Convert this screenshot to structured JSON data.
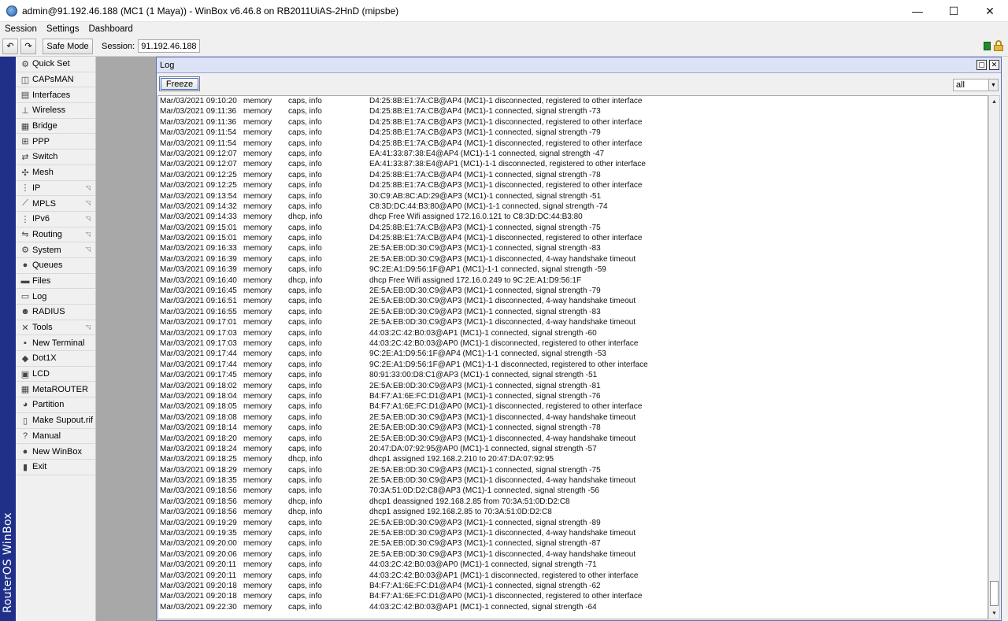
{
  "window": {
    "title": "admin@91.192.46.188 (MC1 (1 Maya)) - WinBox v6.46.8 on RB2011UiAS-2HnD (mipsbe)",
    "minimize": "—",
    "maximize": "☐",
    "close": "✕"
  },
  "menu": [
    "Session",
    "Settings",
    "Dashboard"
  ],
  "toolbar": {
    "undo": "↶",
    "redo": "↷",
    "safe_mode": "Safe Mode",
    "session_label": "Session:",
    "session_value": "91.192.46.188"
  },
  "brand_strip": "RouterOS WinBox",
  "sidebar": [
    {
      "label": "Quick Set",
      "icon": "quickset-icon",
      "glyph": "⚙",
      "submenu": false
    },
    {
      "label": "CAPsMAN",
      "icon": "capsman-icon",
      "glyph": "◫",
      "submenu": false
    },
    {
      "label": "Interfaces",
      "icon": "interfaces-icon",
      "glyph": "▤",
      "submenu": false
    },
    {
      "label": "Wireless",
      "icon": "wireless-icon",
      "glyph": "⊥",
      "submenu": false
    },
    {
      "label": "Bridge",
      "icon": "bridge-icon",
      "glyph": "▦",
      "submenu": false
    },
    {
      "label": "PPP",
      "icon": "ppp-icon",
      "glyph": "⊞",
      "submenu": false
    },
    {
      "label": "Switch",
      "icon": "switch-icon",
      "glyph": "⇄",
      "submenu": false
    },
    {
      "label": "Mesh",
      "icon": "mesh-icon",
      "glyph": "✣",
      "submenu": false
    },
    {
      "label": "IP",
      "icon": "ip-icon",
      "glyph": "⋮",
      "submenu": true
    },
    {
      "label": "MPLS",
      "icon": "mpls-icon",
      "glyph": "⟋",
      "submenu": true
    },
    {
      "label": "IPv6",
      "icon": "ipv6-icon",
      "glyph": "⋮",
      "submenu": true
    },
    {
      "label": "Routing",
      "icon": "routing-icon",
      "glyph": "⇋",
      "submenu": true
    },
    {
      "label": "System",
      "icon": "system-icon",
      "glyph": "⚙",
      "submenu": true
    },
    {
      "label": "Queues",
      "icon": "queues-icon",
      "glyph": "●",
      "submenu": false
    },
    {
      "label": "Files",
      "icon": "files-icon",
      "glyph": "▬",
      "submenu": false
    },
    {
      "label": "Log",
      "icon": "log-icon",
      "glyph": "▭",
      "submenu": false
    },
    {
      "label": "RADIUS",
      "icon": "radius-icon",
      "glyph": "☻",
      "submenu": false
    },
    {
      "label": "Tools",
      "icon": "tools-icon",
      "glyph": "✕",
      "submenu": true
    },
    {
      "label": "New Terminal",
      "icon": "terminal-icon",
      "glyph": "▪",
      "submenu": false
    },
    {
      "label": "Dot1X",
      "icon": "dot1x-icon",
      "glyph": "◆",
      "submenu": false
    },
    {
      "label": "LCD",
      "icon": "lcd-icon",
      "glyph": "▣",
      "submenu": false
    },
    {
      "label": "MetaROUTER",
      "icon": "metarouter-icon",
      "glyph": "▦",
      "submenu": false
    },
    {
      "label": "Partition",
      "icon": "partition-icon",
      "glyph": "◕",
      "submenu": false
    },
    {
      "label": "Make Supout.rif",
      "icon": "supout-icon",
      "glyph": "▯",
      "submenu": false
    },
    {
      "label": "Manual",
      "icon": "manual-icon",
      "glyph": "?",
      "submenu": false
    },
    {
      "label": "New WinBox",
      "icon": "winbox-icon",
      "glyph": "●",
      "submenu": false
    },
    {
      "label": "Exit",
      "icon": "exit-icon",
      "glyph": "▮",
      "submenu": false
    }
  ],
  "log_window": {
    "title": "Log",
    "freeze": "Freeze",
    "filter": "all",
    "rows": [
      [
        "Mar/03/2021 09:10:20",
        "memory",
        "caps, info",
        "D4:25:8B:E1:7A:CB@AP4 (MC1)-1 disconnected, registered to other interface"
      ],
      [
        "Mar/03/2021 09:11:36",
        "memory",
        "caps, info",
        "D4:25:8B:E1:7A:CB@AP4 (MC1)-1 connected, signal strength -73"
      ],
      [
        "Mar/03/2021 09:11:36",
        "memory",
        "caps, info",
        "D4:25:8B:E1:7A:CB@AP3 (MC1)-1 disconnected, registered to other interface"
      ],
      [
        "Mar/03/2021 09:11:54",
        "memory",
        "caps, info",
        "D4:25:8B:E1:7A:CB@AP3 (MC1)-1 connected, signal strength -79"
      ],
      [
        "Mar/03/2021 09:11:54",
        "memory",
        "caps, info",
        "D4:25:8B:E1:7A:CB@AP4 (MC1)-1 disconnected, registered to other interface"
      ],
      [
        "Mar/03/2021 09:12:07",
        "memory",
        "caps, info",
        "EA:41:33:87:38:E4@AP4 (MC1)-1-1 connected, signal strength -47"
      ],
      [
        "Mar/03/2021 09:12:07",
        "memory",
        "caps, info",
        "EA:41:33:87:38:E4@AP1 (MC1)-1-1 disconnected, registered to other interface"
      ],
      [
        "Mar/03/2021 09:12:25",
        "memory",
        "caps, info",
        "D4:25:8B:E1:7A:CB@AP4 (MC1)-1 connected, signal strength -78"
      ],
      [
        "Mar/03/2021 09:12:25",
        "memory",
        "caps, info",
        "D4:25:8B:E1:7A:CB@AP3 (MC1)-1 disconnected, registered to other interface"
      ],
      [
        "Mar/03/2021 09:13:54",
        "memory",
        "caps, info",
        "30:C9:AB:8C:AD:29@AP3 (MC1)-1 connected, signal strength -51"
      ],
      [
        "Mar/03/2021 09:14:32",
        "memory",
        "caps, info",
        "C8:3D:DC:44:B3:80@AP0 (MC1)-1-1 connected, signal strength -74"
      ],
      [
        "Mar/03/2021 09:14:33",
        "memory",
        "dhcp, info",
        "dhcp Free Wifi assigned 172.16.0.121 to C8:3D:DC:44:B3:80"
      ],
      [
        "Mar/03/2021 09:15:01",
        "memory",
        "caps, info",
        "D4:25:8B:E1:7A:CB@AP3 (MC1)-1 connected, signal strength -75"
      ],
      [
        "Mar/03/2021 09:15:01",
        "memory",
        "caps, info",
        "D4:25:8B:E1:7A:CB@AP4 (MC1)-1 disconnected, registered to other interface"
      ],
      [
        "Mar/03/2021 09:16:33",
        "memory",
        "caps, info",
        "2E:5A:EB:0D:30:C9@AP3 (MC1)-1 connected, signal strength -83"
      ],
      [
        "Mar/03/2021 09:16:39",
        "memory",
        "caps, info",
        "2E:5A:EB:0D:30:C9@AP3 (MC1)-1 disconnected, 4-way handshake timeout"
      ],
      [
        "Mar/03/2021 09:16:39",
        "memory",
        "caps, info",
        "9C:2E:A1:D9:56:1F@AP1 (MC1)-1-1 connected, signal strength -59"
      ],
      [
        "Mar/03/2021 09:16:40",
        "memory",
        "dhcp, info",
        "dhcp Free Wifi assigned 172.16.0.249 to 9C:2E:A1:D9:56:1F"
      ],
      [
        "Mar/03/2021 09:16:45",
        "memory",
        "caps, info",
        "2E:5A:EB:0D:30:C9@AP3 (MC1)-1 connected, signal strength -79"
      ],
      [
        "Mar/03/2021 09:16:51",
        "memory",
        "caps, info",
        "2E:5A:EB:0D:30:C9@AP3 (MC1)-1 disconnected, 4-way handshake timeout"
      ],
      [
        "Mar/03/2021 09:16:55",
        "memory",
        "caps, info",
        "2E:5A:EB:0D:30:C9@AP3 (MC1)-1 connected, signal strength -83"
      ],
      [
        "Mar/03/2021 09:17:01",
        "memory",
        "caps, info",
        "2E:5A:EB:0D:30:C9@AP3 (MC1)-1 disconnected, 4-way handshake timeout"
      ],
      [
        "Mar/03/2021 09:17:03",
        "memory",
        "caps, info",
        "44:03:2C:42:B0:03@AP1 (MC1)-1 connected, signal strength -60"
      ],
      [
        "Mar/03/2021 09:17:03",
        "memory",
        "caps, info",
        "44:03:2C:42:B0:03@AP0 (MC1)-1 disconnected, registered to other interface"
      ],
      [
        "Mar/03/2021 09:17:44",
        "memory",
        "caps, info",
        "9C:2E:A1:D9:56:1F@AP4 (MC1)-1-1 connected, signal strength -53"
      ],
      [
        "Mar/03/2021 09:17:44",
        "memory",
        "caps, info",
        "9C:2E:A1:D9:56:1F@AP1 (MC1)-1-1 disconnected, registered to other interface"
      ],
      [
        "Mar/03/2021 09:17:45",
        "memory",
        "caps, info",
        "80:91:33:00:D8:C1@AP3 (MC1)-1 connected, signal strength -51"
      ],
      [
        "Mar/03/2021 09:18:02",
        "memory",
        "caps, info",
        "2E:5A:EB:0D:30:C9@AP3 (MC1)-1 connected, signal strength -81"
      ],
      [
        "Mar/03/2021 09:18:04",
        "memory",
        "caps, info",
        "B4:F7:A1:6E:FC:D1@AP1 (MC1)-1 connected, signal strength -76"
      ],
      [
        "Mar/03/2021 09:18:05",
        "memory",
        "caps, info",
        "B4:F7:A1:6E:FC:D1@AP0 (MC1)-1 disconnected, registered to other interface"
      ],
      [
        "Mar/03/2021 09:18:08",
        "memory",
        "caps, info",
        "2E:5A:EB:0D:30:C9@AP3 (MC1)-1 disconnected, 4-way handshake timeout"
      ],
      [
        "Mar/03/2021 09:18:14",
        "memory",
        "caps, info",
        "2E:5A:EB:0D:30:C9@AP3 (MC1)-1 connected, signal strength -78"
      ],
      [
        "Mar/03/2021 09:18:20",
        "memory",
        "caps, info",
        "2E:5A:EB:0D:30:C9@AP3 (MC1)-1 disconnected, 4-way handshake timeout"
      ],
      [
        "Mar/03/2021 09:18:24",
        "memory",
        "caps, info",
        "20:47:DA:07:92:95@AP0 (MC1)-1 connected, signal strength -57"
      ],
      [
        "Mar/03/2021 09:18:25",
        "memory",
        "dhcp, info",
        "dhcp1 assigned 192.168.2.210 to 20:47:DA:07:92:95"
      ],
      [
        "Mar/03/2021 09:18:29",
        "memory",
        "caps, info",
        "2E:5A:EB:0D:30:C9@AP3 (MC1)-1 connected, signal strength -75"
      ],
      [
        "Mar/03/2021 09:18:35",
        "memory",
        "caps, info",
        "2E:5A:EB:0D:30:C9@AP3 (MC1)-1 disconnected, 4-way handshake timeout"
      ],
      [
        "Mar/03/2021 09:18:56",
        "memory",
        "caps, info",
        "70:3A:51:0D:D2:C8@AP3 (MC1)-1 connected, signal strength -56"
      ],
      [
        "Mar/03/2021 09:18:56",
        "memory",
        "dhcp, info",
        "dhcp1 deassigned 192.168.2.85 from 70:3A:51:0D:D2:C8"
      ],
      [
        "Mar/03/2021 09:18:56",
        "memory",
        "dhcp, info",
        "dhcp1 assigned 192.168.2.85 to 70:3A:51:0D:D2:C8"
      ],
      [
        "Mar/03/2021 09:19:29",
        "memory",
        "caps, info",
        "2E:5A:EB:0D:30:C9@AP3 (MC1)-1 connected, signal strength -89"
      ],
      [
        "Mar/03/2021 09:19:35",
        "memory",
        "caps, info",
        "2E:5A:EB:0D:30:C9@AP3 (MC1)-1 disconnected, 4-way handshake timeout"
      ],
      [
        "Mar/03/2021 09:20:00",
        "memory",
        "caps, info",
        "2E:5A:EB:0D:30:C9@AP3 (MC1)-1 connected, signal strength -87"
      ],
      [
        "Mar/03/2021 09:20:06",
        "memory",
        "caps, info",
        "2E:5A:EB:0D:30:C9@AP3 (MC1)-1 disconnected, 4-way handshake timeout"
      ],
      [
        "Mar/03/2021 09:20:11",
        "memory",
        "caps, info",
        "44:03:2C:42:B0:03@AP0 (MC1)-1 connected, signal strength -71"
      ],
      [
        "Mar/03/2021 09:20:11",
        "memory",
        "caps, info",
        "44:03:2C:42:B0:03@AP1 (MC1)-1 disconnected, registered to other interface"
      ],
      [
        "Mar/03/2021 09:20:18",
        "memory",
        "caps, info",
        "B4:F7:A1:6E:FC:D1@AP4 (MC1)-1 connected, signal strength -62"
      ],
      [
        "Mar/03/2021 09:20:18",
        "memory",
        "caps, info",
        "B4:F7:A1:6E:FC:D1@AP0 (MC1)-1 disconnected, registered to other interface"
      ],
      [
        "Mar/03/2021 09:22:30",
        "memory",
        "caps, info",
        "44:03:2C:42:B0:03@AP1 (MC1)-1 connected, signal strength -64"
      ]
    ]
  },
  "colors": {
    "brand_strip": "#1f2f8a",
    "log_title_bg": "#dde3f7",
    "status_green": "#1e8c2a"
  }
}
